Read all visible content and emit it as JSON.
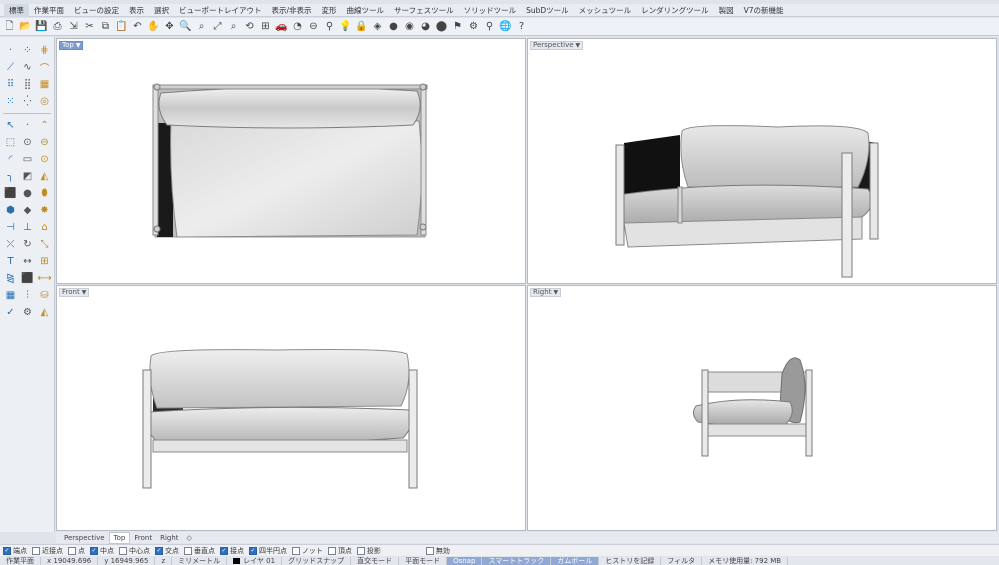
{
  "menu": [
    "標準",
    "作業平面",
    "ビューの設定",
    "表示",
    "選択",
    "ビューポートレイアウト",
    "表示/非表示",
    "変形",
    "曲線ツール",
    "サーフェスツール",
    "ソリッドツール",
    "SubDツール",
    "メッシュツール",
    "レンダリングツール",
    "製図",
    "V7の新機能"
  ],
  "toolbar_icons": [
    {
      "name": "new-file-icon",
      "glyph": "🗋"
    },
    {
      "name": "open-file-icon",
      "glyph": "📂"
    },
    {
      "name": "save-icon",
      "glyph": "💾"
    },
    {
      "name": "print-icon",
      "glyph": "⎙"
    },
    {
      "name": "import-icon",
      "glyph": "⇲"
    },
    {
      "name": "cut-icon",
      "glyph": "✂"
    },
    {
      "name": "copy-icon",
      "glyph": "⧉"
    },
    {
      "name": "paste-icon",
      "glyph": "📋"
    },
    {
      "name": "undo-icon",
      "glyph": "↶"
    },
    {
      "name": "pan-icon",
      "glyph": "✋"
    },
    {
      "name": "rotate-view-icon",
      "glyph": "✥"
    },
    {
      "name": "zoom-icon",
      "glyph": "🔍"
    },
    {
      "name": "zoom-window-icon",
      "glyph": "⌕"
    },
    {
      "name": "zoom-extents-icon",
      "glyph": "⤢"
    },
    {
      "name": "zoom-selected-icon",
      "glyph": "⌕"
    },
    {
      "name": "undo-view-icon",
      "glyph": "⟲"
    },
    {
      "name": "four-view-icon",
      "glyph": "⊞"
    },
    {
      "name": "car-icon",
      "glyph": "🚗"
    },
    {
      "name": "hide-icon",
      "glyph": "◔"
    },
    {
      "name": "named-view-icon",
      "glyph": "⊖"
    },
    {
      "name": "select-icon",
      "glyph": "⚲"
    },
    {
      "name": "light-icon",
      "glyph": "💡"
    },
    {
      "name": "lock-icon",
      "glyph": "🔒"
    },
    {
      "name": "layer-icon",
      "glyph": "◈"
    },
    {
      "name": "color-wheel-icon",
      "glyph": "●"
    },
    {
      "name": "material-icon",
      "glyph": "◉"
    },
    {
      "name": "render-icon",
      "glyph": "◕"
    },
    {
      "name": "sphere-icon",
      "glyph": "⬤"
    },
    {
      "name": "flag-icon",
      "glyph": "⚑"
    },
    {
      "name": "grasshopper-icon",
      "glyph": "⚙"
    },
    {
      "name": "options-icon",
      "glyph": "⚲"
    },
    {
      "name": "globe-icon",
      "glyph": "🌐"
    },
    {
      "name": "help-icon",
      "glyph": "?"
    }
  ],
  "left_tools": [
    {
      "name": "point-icon",
      "glyph": "·"
    },
    {
      "name": "point-cloud-icon",
      "glyph": "⁘"
    },
    {
      "name": "grid-points-icon",
      "glyph": "⋕"
    },
    {
      "name": "polyline-icon",
      "glyph": "⟋"
    },
    {
      "name": "curve-icon",
      "glyph": "∿"
    },
    {
      "name": "interp-curve-icon",
      "glyph": "⌒"
    },
    {
      "name": "control-points-icon",
      "glyph": "⠿"
    },
    {
      "name": "dense-grid-icon",
      "glyph": "⣿"
    },
    {
      "name": "mesh-grid-icon",
      "glyph": "▦"
    },
    {
      "name": "scatter-icon",
      "glyph": "⁙"
    },
    {
      "name": "scatter2-icon",
      "glyph": "⁛"
    },
    {
      "name": "eye-icon",
      "glyph": "◎"
    },
    {
      "name": "select-arrow-icon",
      "glyph": "↖"
    },
    {
      "name": "dot-icon",
      "glyph": "·"
    },
    {
      "name": "polygon-curve-icon",
      "glyph": "⌃"
    },
    {
      "name": "rect-select-icon",
      "glyph": "⬚"
    },
    {
      "name": "circle-icon",
      "glyph": "⊙"
    },
    {
      "name": "ellipse-icon",
      "glyph": "⊖"
    },
    {
      "name": "arc-icon",
      "glyph": "◜"
    },
    {
      "name": "rectangle-icon",
      "glyph": "▭"
    },
    {
      "name": "circle-center-icon",
      "glyph": "⊙"
    },
    {
      "name": "fillet-icon",
      "glyph": "╮"
    },
    {
      "name": "surface-icon",
      "glyph": "◩"
    },
    {
      "name": "loft-icon",
      "glyph": "◭"
    },
    {
      "name": "box-icon",
      "glyph": "⬛"
    },
    {
      "name": "sphere-solid-icon",
      "glyph": "●"
    },
    {
      "name": "cylinder-icon",
      "glyph": "⬮"
    },
    {
      "name": "extrude-icon",
      "glyph": "⬢"
    },
    {
      "name": "boolean-icon",
      "glyph": "◆"
    },
    {
      "name": "explode-icon",
      "glyph": "✸"
    },
    {
      "name": "trim-icon",
      "glyph": "⊣"
    },
    {
      "name": "split-icon",
      "glyph": "⊥"
    },
    {
      "name": "join-icon",
      "glyph": "⌂"
    },
    {
      "name": "move-icon",
      "glyph": "⤫"
    },
    {
      "name": "rotate-icon",
      "glyph": "↻"
    },
    {
      "name": "scale-icon",
      "glyph": "⤡"
    },
    {
      "name": "text-icon",
      "glyph": "T"
    },
    {
      "name": "dimension-icon",
      "glyph": "↔"
    },
    {
      "name": "array-icon",
      "glyph": "⊞"
    },
    {
      "name": "mirror-icon",
      "glyph": "⧎"
    },
    {
      "name": "cube-solid-icon",
      "glyph": "⬛"
    },
    {
      "name": "orient-icon",
      "glyph": "⟷"
    },
    {
      "name": "grid-snap-icon",
      "glyph": "▦"
    },
    {
      "name": "analyze-icon",
      "glyph": "⫶"
    },
    {
      "name": "bucket-icon",
      "glyph": "⛁"
    },
    {
      "name": "check-icon",
      "glyph": "✓"
    },
    {
      "name": "gear-tools-icon",
      "glyph": "⚙"
    },
    {
      "name": "paint-icon",
      "glyph": "◭"
    }
  ],
  "viewports": [
    {
      "id": "top",
      "label": "Top",
      "active": true
    },
    {
      "id": "perspective",
      "label": "Perspective",
      "active": false
    },
    {
      "id": "front",
      "label": "Front",
      "active": false
    },
    {
      "id": "right",
      "label": "Right",
      "active": false
    }
  ],
  "viewport_tabs": [
    "Perspective",
    "Top",
    "Front",
    "Right",
    "◇"
  ],
  "osnaps": [
    {
      "label": "端点",
      "checked": true
    },
    {
      "label": "近接点",
      "checked": false
    },
    {
      "label": "点",
      "checked": false
    },
    {
      "label": "中点",
      "checked": true
    },
    {
      "label": "中心点",
      "checked": false
    },
    {
      "label": "交点",
      "checked": true
    },
    {
      "label": "垂直点",
      "checked": false
    },
    {
      "label": "接点",
      "checked": true
    },
    {
      "label": "四半円点",
      "checked": true
    },
    {
      "label": "ノット",
      "checked": false
    },
    {
      "label": "頂点",
      "checked": false
    },
    {
      "label": "投影",
      "checked": false
    },
    {
      "label": "無効",
      "checked": false
    }
  ],
  "status": {
    "cplane": "作業平面",
    "x": "x 19049.696",
    "y": "y 16949.965",
    "z": "z",
    "units": "ミリメートル",
    "layer": "レイヤ 01",
    "grid_snap": "グリッドスナップ",
    "ortho": "直交モード",
    "planar": "平面モード",
    "osnap": "Osnap",
    "smarttrack": "スマートトラック",
    "gumball": "ガムボール",
    "history": "ヒストリを記録",
    "filter": "フィルタ",
    "memory": "メモリ使用量: 792 MB"
  }
}
